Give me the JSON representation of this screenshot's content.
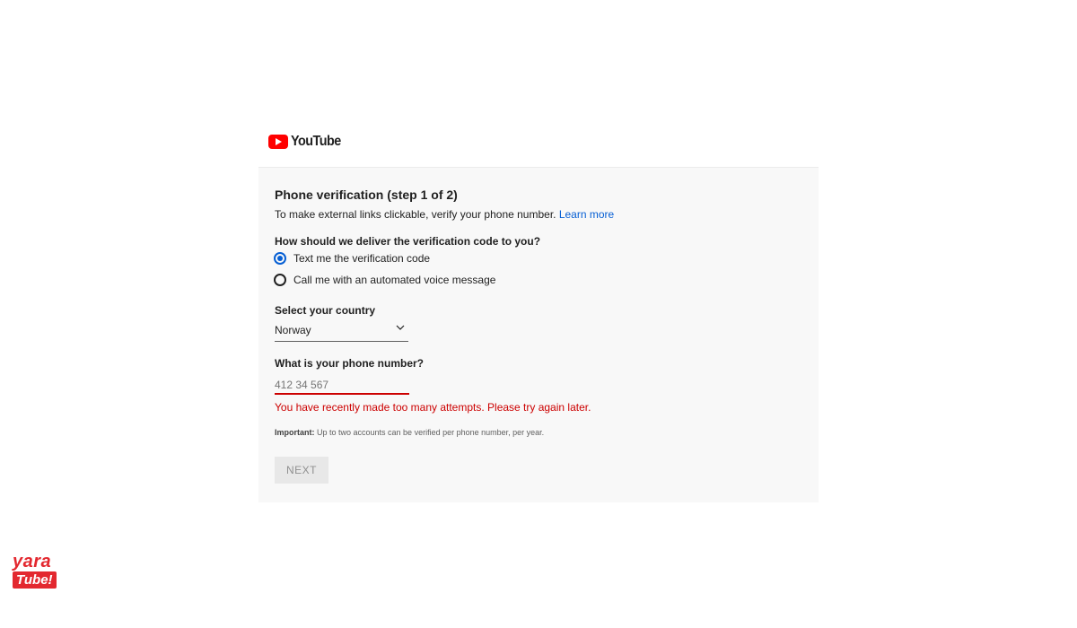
{
  "logo": {
    "brand": "YouTube",
    "accent_color": "#ff0000"
  },
  "card": {
    "title": "Phone verification (step 1 of 2)",
    "subtitle": "To make external links clickable, verify your phone number.",
    "learn_more": "Learn more"
  },
  "delivery": {
    "question": "How should we deliver the verification code to you?",
    "options": [
      {
        "label": "Text me the verification code",
        "selected": true
      },
      {
        "label": "Call me with an automated voice message",
        "selected": false
      }
    ]
  },
  "country": {
    "label": "Select your country",
    "value": "Norway"
  },
  "phone": {
    "label": "What is your phone number?",
    "placeholder": "412 34 567",
    "error": "You have recently made too many attempts. Please try again later.",
    "error_color": "#cc0000"
  },
  "note": {
    "bold": "Important:",
    "text": " Up to two accounts can be verified per phone number, per year."
  },
  "next_label": "NEXT",
  "watermark": {
    "line1": "yara",
    "line2": "Tube!"
  }
}
